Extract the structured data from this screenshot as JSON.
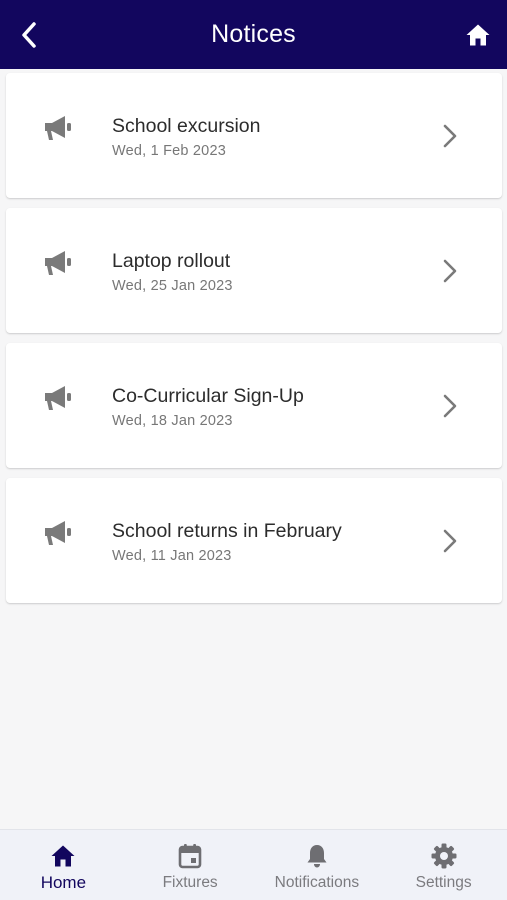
{
  "header": {
    "title": "Notices",
    "back_icon": "chevron-left-icon",
    "home_icon": "home-icon"
  },
  "notices": [
    {
      "title": "School excursion",
      "date": "Wed, 1 Feb 2023",
      "icon": "megaphone-icon"
    },
    {
      "title": "Laptop rollout",
      "date": "Wed, 25 Jan 2023",
      "icon": "megaphone-icon"
    },
    {
      "title": "Co-Curricular Sign-Up",
      "date": "Wed, 18 Jan 2023",
      "icon": "megaphone-icon"
    },
    {
      "title": "School returns in February",
      "date": "Wed, 11 Jan 2023",
      "icon": "megaphone-icon"
    }
  ],
  "bottom_nav": {
    "items": [
      {
        "label": "Home",
        "icon": "home-icon",
        "active": true
      },
      {
        "label": "Fixtures",
        "icon": "calendar-icon",
        "active": false
      },
      {
        "label": "Notifications",
        "icon": "bell-icon",
        "active": false
      },
      {
        "label": "Settings",
        "icon": "gear-icon",
        "active": false
      }
    ]
  },
  "colors": {
    "header_bg": "#12065e",
    "accent": "#12065e",
    "icon_gray": "#7a7a7a",
    "background": "#f6f6f7",
    "nav_bg": "#f0f2f8"
  }
}
